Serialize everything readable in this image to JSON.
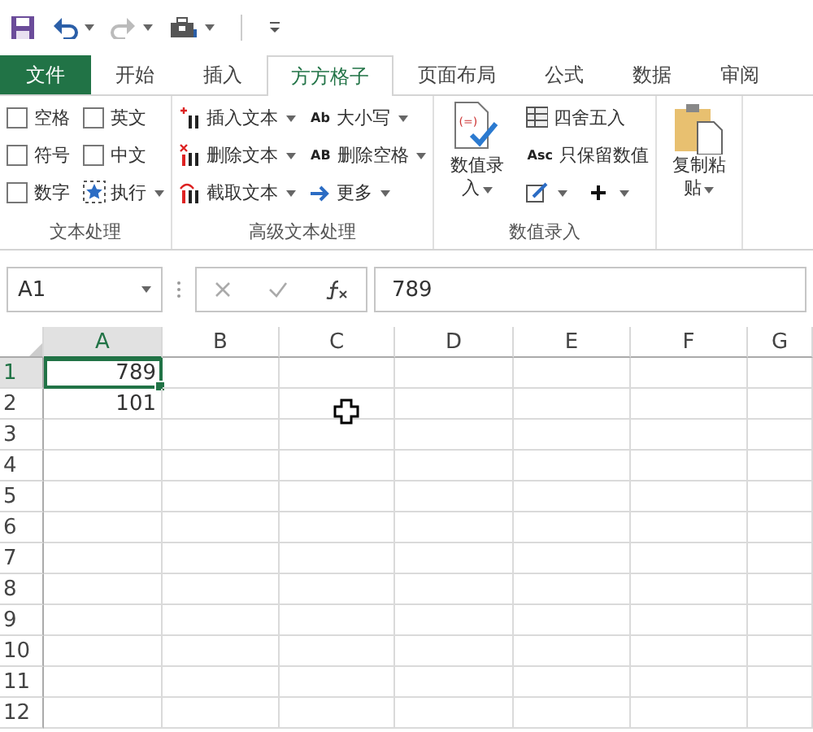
{
  "tabs": [
    {
      "label": "文件",
      "kind": "file",
      "selected": false
    },
    {
      "label": "开始",
      "kind": "tab",
      "selected": false
    },
    {
      "label": "插入",
      "kind": "tab",
      "selected": false
    },
    {
      "label": "方方格子",
      "kind": "tab",
      "selected": true
    },
    {
      "label": "页面布局",
      "kind": "tab",
      "selected": false
    },
    {
      "label": "公式",
      "kind": "tab",
      "selected": false
    },
    {
      "label": "数据",
      "kind": "tab",
      "selected": false
    },
    {
      "label": "审阅",
      "kind": "tab",
      "selected": false
    }
  ],
  "ribbon": {
    "groups": [
      {
        "label": "文本处理",
        "items": [
          {
            "kind": "check",
            "label": "空格",
            "checked": false
          },
          {
            "kind": "check",
            "label": "英文",
            "checked": false
          },
          {
            "kind": "check",
            "label": "符号",
            "checked": false
          },
          {
            "kind": "check",
            "label": "中文",
            "checked": false
          },
          {
            "kind": "check",
            "label": "数字",
            "checked": false
          },
          {
            "kind": "action",
            "label": "执行",
            "menu": true
          }
        ]
      },
      {
        "label": "高级文本处理",
        "items": [
          {
            "kind": "action",
            "label": "插入文本",
            "menu": true
          },
          {
            "kind": "action",
            "label": "删除文本",
            "menu": true
          },
          {
            "kind": "action",
            "label": "截取文本",
            "menu": true
          },
          {
            "kind": "action",
            "label": "大小写",
            "icon_text": "Ab",
            "menu": true
          },
          {
            "kind": "action",
            "label": "删除空格",
            "icon_text": "AB",
            "menu": true
          },
          {
            "kind": "action",
            "label": "更多",
            "menu": true
          }
        ]
      },
      {
        "label": "数值录入",
        "items": [
          {
            "kind": "large",
            "label": "数值录入",
            "icon_text": "(=)",
            "menu": true
          },
          {
            "kind": "action",
            "label": "四舍五入",
            "menu": false
          },
          {
            "kind": "action",
            "label": "只保留数值",
            "icon_text": "Asc",
            "menu": false
          },
          {
            "kind": "iconmenu",
            "menu": true
          },
          {
            "kind": "iconmenu",
            "menu": true
          }
        ]
      },
      {
        "items": [
          {
            "kind": "large",
            "label": "复制粘贴",
            "menu": true
          }
        ]
      }
    ]
  },
  "formula_bar": {
    "name_box": "A1",
    "formula": "789"
  },
  "sheet": {
    "columns": [
      {
        "label": "A",
        "selected": true
      },
      {
        "label": "B",
        "selected": false
      },
      {
        "label": "C",
        "selected": false
      },
      {
        "label": "D",
        "selected": false
      },
      {
        "label": "E",
        "selected": false
      },
      {
        "label": "F",
        "selected": false
      },
      {
        "label": "G",
        "selected": false
      }
    ],
    "rows": [
      {
        "label": "1",
        "selected": true,
        "cells": [
          {
            "text": "789",
            "selected": true
          }
        ]
      },
      {
        "label": "2",
        "selected": false,
        "cells": [
          {
            "text": "101",
            "selected": false
          }
        ]
      },
      {
        "label": "3",
        "selected": false
      },
      {
        "label": "4",
        "selected": false
      },
      {
        "label": "5",
        "selected": false
      },
      {
        "label": "6",
        "selected": false
      },
      {
        "label": "7",
        "selected": false
      },
      {
        "label": "8",
        "selected": false
      },
      {
        "label": "9",
        "selected": false
      },
      {
        "label": "10",
        "selected": false
      },
      {
        "label": "11",
        "selected": false
      },
      {
        "label": "12",
        "selected": false
      }
    ]
  }
}
